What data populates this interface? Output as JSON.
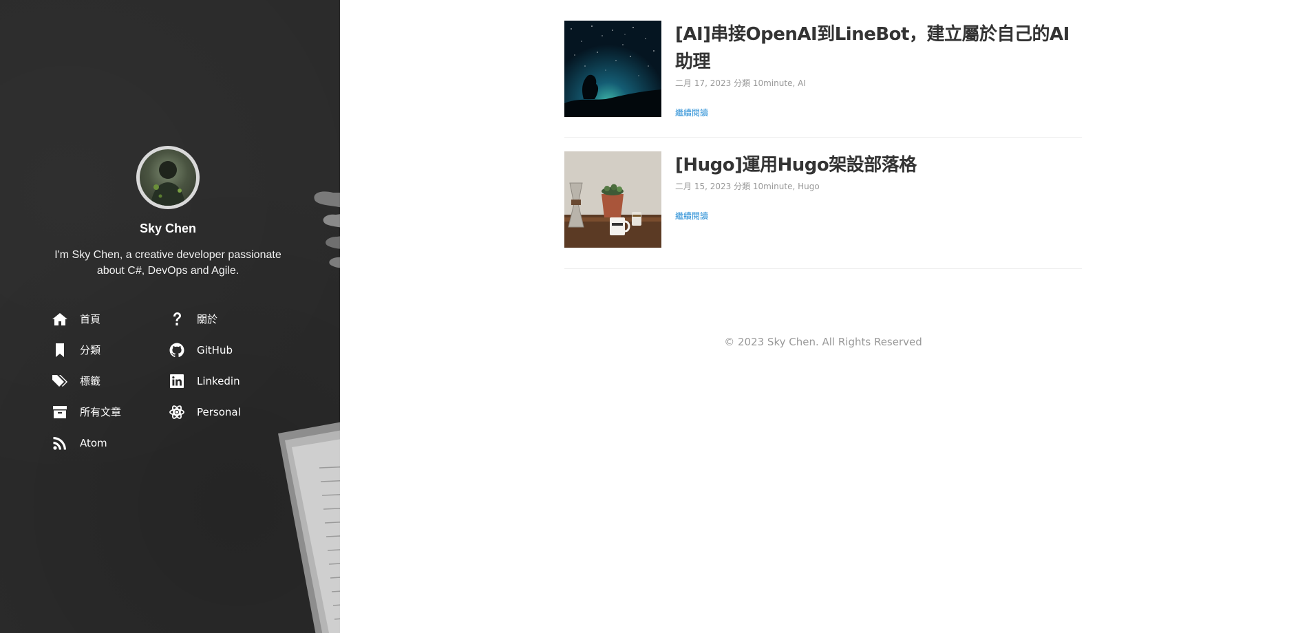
{
  "sidebar": {
    "author_name": "Sky Chen",
    "bio": "I'm Sky Chen, a creative developer passionate about C#, DevOps and Agile.",
    "nav": [
      {
        "label": "首頁",
        "icon": "home-icon"
      },
      {
        "label": "關於",
        "icon": "question-icon"
      },
      {
        "label": "分類",
        "icon": "bookmark-icon"
      },
      {
        "label": "GitHub",
        "icon": "github-icon"
      },
      {
        "label": "標籤",
        "icon": "tags-icon"
      },
      {
        "label": "Linkedin",
        "icon": "linkedin-icon"
      },
      {
        "label": "所有文章",
        "icon": "archive-icon"
      },
      {
        "label": "Personal",
        "icon": "atom-icon"
      },
      {
        "label": "Atom",
        "icon": "rss-icon"
      }
    ]
  },
  "posts": [
    {
      "title": "[AI]串接OpenAI到LineBot，建立屬於自己的AI助理",
      "meta": "二月 17, 2023 分類 10minute, AI",
      "read_more": "繼續閱讀"
    },
    {
      "title": "[Hugo]運用Hugo架設部落格",
      "meta": "二月 15, 2023 分類 10minute, Hugo",
      "read_more": "繼續閱讀"
    }
  ],
  "footer": {
    "copyright": "© 2023 Sky Chen. All Rights Reserved"
  },
  "colors": {
    "sidebar_bg": "#2b2b2b",
    "title_text": "#333333",
    "meta_text": "#999999",
    "link": "#2a8fd6"
  }
}
